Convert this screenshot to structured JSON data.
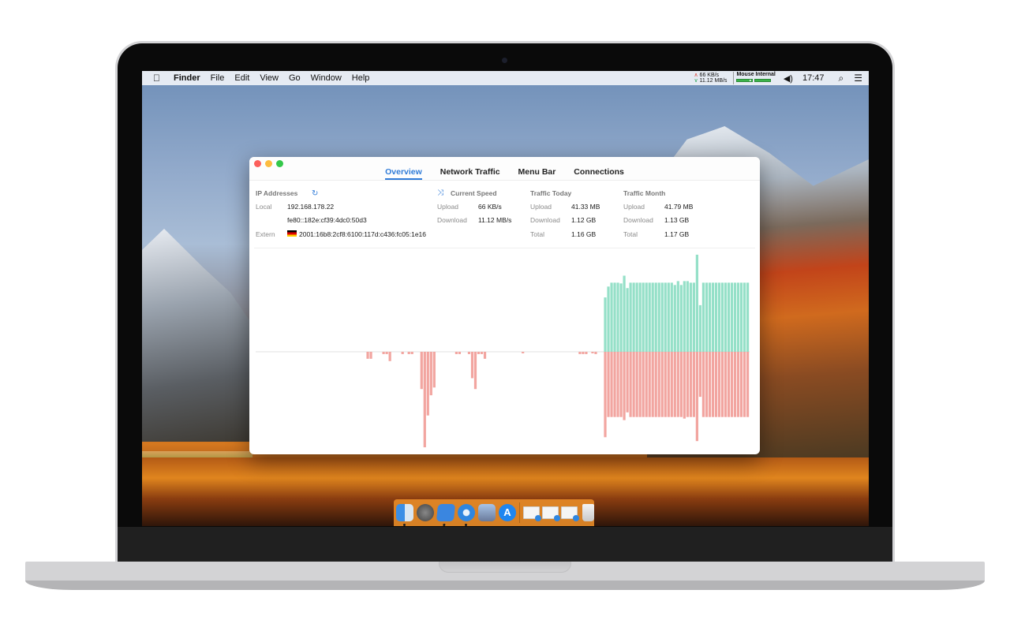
{
  "menubar": {
    "apple_icon": "apple-icon",
    "items": [
      "Finder",
      "File",
      "Edit",
      "View",
      "Go",
      "Window",
      "Help"
    ],
    "speed_upload": "66 KB/s",
    "speed_download": "11.12 MB/s",
    "mouse_label": "Mouse Internal",
    "mouse_battery_levels": [
      0.85,
      1.0
    ],
    "volume_icon": "volume-icon",
    "clock": "17:47",
    "search_icon": "spotlight-search-icon",
    "list_icon": "notification-center-icon",
    "glyphs": {
      "apple": "",
      "up": "∧",
      "down": "∨",
      "volume": "◀)",
      "search": "⌕",
      "list": "☰"
    }
  },
  "window": {
    "tabs": [
      {
        "label": "Overview",
        "active": true
      },
      {
        "label": "Network Traffic",
        "active": false
      },
      {
        "label": "Menu Bar",
        "active": false
      },
      {
        "label": "Connections",
        "active": false
      }
    ],
    "ip": {
      "heading": "IP Addresses",
      "refresh_glyph": "↻",
      "local_label": "Local",
      "local_v4": "192.168.178.22",
      "local_v6": "fe80::182e:cf39:4dc0:50d3",
      "extern_label": "Extern",
      "extern_flag": "germany-flag",
      "extern_value": "2001:16b8:2cf8:6100:117d:c436:fc05:1e16"
    },
    "current_speed": {
      "heading": "Current Speed",
      "shuffle_glyph": "⤨",
      "upload_label": "Upload",
      "upload": "66 KB/s",
      "download_label": "Download",
      "download": "11.12 MB/s"
    },
    "traffic_today": {
      "heading": "Traffic Today",
      "upload_label": "Upload",
      "upload": "41.33 MB",
      "download_label": "Download",
      "download": "1.12 GB",
      "total_label": "Total",
      "total": "1.16 GB"
    },
    "traffic_month": {
      "heading": "Traffic Month",
      "upload_label": "Upload",
      "upload": "41.79 MB",
      "download_label": "Download",
      "download": "1.13 GB",
      "total_label": "Total",
      "total": "1.17 GB"
    }
  },
  "colors": {
    "accent": "#2f7bd8",
    "upload_bar": "#95e0c8",
    "download_bar": "#f2a5a0"
  },
  "chart_data": {
    "type": "bar",
    "title": "",
    "xlabel": "",
    "ylabel": "",
    "description": "Mirrored bar chart: upload (green) above baseline, download (red) below baseline; relative units",
    "ylim": [
      -130,
      130
    ],
    "slots": 156,
    "series": [
      {
        "name": "upload",
        "color": "#95e0c8",
        "values": [
          0,
          0,
          0,
          0,
          0,
          0,
          0,
          0,
          0,
          0,
          0,
          0,
          0,
          0,
          0,
          0,
          0,
          0,
          0,
          0,
          0,
          0,
          0,
          0,
          0,
          0,
          0,
          0,
          0,
          0,
          0,
          0,
          0,
          0,
          0,
          0,
          0,
          0,
          0,
          0,
          0,
          0,
          0,
          0,
          0,
          0,
          0,
          0,
          0,
          0,
          0,
          0,
          0,
          0,
          0,
          0,
          0,
          0,
          0,
          0,
          0,
          0,
          0,
          0,
          0,
          0,
          0,
          0,
          0,
          0,
          0,
          0,
          0,
          0,
          0,
          0,
          0,
          0,
          0,
          0,
          0,
          0,
          0,
          0,
          0,
          0,
          0,
          0,
          0,
          0,
          0,
          0,
          0,
          0,
          0,
          0,
          0,
          0,
          0,
          0,
          0,
          0,
          0,
          0,
          0,
          0,
          0,
          0,
          0,
          0,
          70,
          84,
          89,
          89,
          89,
          88,
          98,
          82,
          89,
          89,
          89,
          89,
          89,
          89,
          89,
          89,
          89,
          89,
          89,
          89,
          89,
          89,
          86,
          91,
          86,
          91,
          91,
          89,
          89,
          125,
          60,
          89,
          89,
          89,
          89,
          89,
          89,
          89,
          89,
          89,
          89,
          89,
          89,
          89,
          89,
          89
        ]
      },
      {
        "name": "download",
        "color": "#f2a5a0",
        "values": [
          0,
          0,
          0,
          0,
          0,
          0,
          0,
          0,
          0,
          0,
          0,
          0,
          0,
          0,
          0,
          0,
          0,
          0,
          0,
          0,
          0,
          0,
          0,
          0,
          0,
          0,
          0,
          0,
          0,
          0,
          0,
          0,
          0,
          0,
          0,
          0,
          0,
          0,
          0,
          0,
          0,
          0,
          0,
          0,
          0,
          0,
          0,
          0,
          0,
          0,
          0,
          0,
          0,
          0,
          0,
          0,
          0,
          0,
          0,
          0,
          0,
          0,
          0,
          0,
          0,
          0,
          0,
          0,
          0,
          0,
          0,
          0,
          0,
          0,
          0,
          0,
          0,
          0,
          0,
          0,
          0,
          0,
          0,
          0,
          0,
          0,
          0,
          0,
          0,
          0,
          0,
          0,
          0,
          0,
          0,
          0,
          0,
          0,
          0,
          0,
          0,
          0,
          0,
          0,
          0,
          0,
          0,
          0,
          0,
          0,
          110,
          84,
          84,
          84,
          84,
          84,
          88,
          78,
          84,
          84,
          84,
          84,
          84,
          84,
          84,
          84,
          84,
          84,
          84,
          84,
          84,
          84,
          84,
          84,
          84,
          86,
          84,
          84,
          84,
          115,
          58,
          84,
          84,
          84,
          84,
          84,
          84,
          84,
          84,
          84,
          84,
          84,
          84,
          84,
          84,
          84
        ]
      }
    ],
    "sparse_download": [
      {
        "slot": 35,
        "value": 9
      },
      {
        "slot": 36,
        "value": 9
      },
      {
        "slot": 40,
        "value": 3
      },
      {
        "slot": 41,
        "value": 3
      },
      {
        "slot": 42,
        "value": 12
      },
      {
        "slot": 46,
        "value": 3
      },
      {
        "slot": 48,
        "value": 3
      },
      {
        "slot": 49,
        "value": 3
      },
      {
        "slot": 52,
        "value": 48
      },
      {
        "slot": 53,
        "value": 123
      },
      {
        "slot": 54,
        "value": 82
      },
      {
        "slot": 55,
        "value": 56
      },
      {
        "slot": 56,
        "value": 46
      },
      {
        "slot": 63,
        "value": 3
      },
      {
        "slot": 64,
        "value": 3
      },
      {
        "slot": 67,
        "value": 3
      },
      {
        "slot": 68,
        "value": 34
      },
      {
        "slot": 69,
        "value": 48
      },
      {
        "slot": 70,
        "value": 3
      },
      {
        "slot": 71,
        "value": 3
      },
      {
        "slot": 72,
        "value": 9
      },
      {
        "slot": 84,
        "value": 2
      },
      {
        "slot": 102,
        "value": 3
      },
      {
        "slot": 103,
        "value": 3
      },
      {
        "slot": 104,
        "value": 3
      },
      {
        "slot": 106,
        "value": 2
      },
      {
        "slot": 107,
        "value": 3
      }
    ]
  },
  "dock": {
    "apps": [
      {
        "name": "finder",
        "running": true
      },
      {
        "name": "launchpad",
        "running": false
      },
      {
        "name": "xcode",
        "running": true
      },
      {
        "name": "safari",
        "running": true
      },
      {
        "name": "preview",
        "running": false
      },
      {
        "name": "app-store",
        "running": false,
        "glyph": "A"
      }
    ],
    "minimized_windows": [
      "minimized-window-1",
      "minimized-window-2",
      "minimized-window-3"
    ],
    "trash": "trash"
  }
}
